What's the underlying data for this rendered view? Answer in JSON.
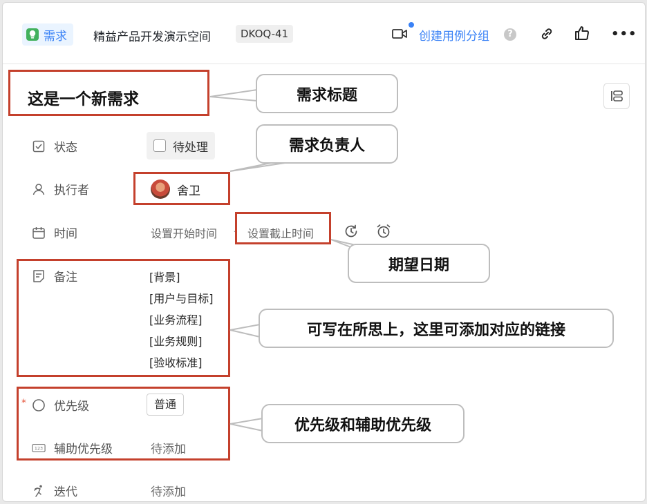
{
  "header": {
    "type_label": "需求",
    "space_name": "精益产品开发演示空间",
    "task_key": "DKOQ-41",
    "create_group_label": "创建用例分组",
    "help_symbol": "?",
    "more_symbol": "•••"
  },
  "title": "这是一个新需求",
  "fields": {
    "status": {
      "label": "状态",
      "value": "待处理"
    },
    "assignee": {
      "label": "执行者",
      "value": "舍卫"
    },
    "time": {
      "label": "时间",
      "start_placeholder": "设置开始时间",
      "separator": "-",
      "end_placeholder": "设置截止时间"
    },
    "notes": {
      "label": "备注",
      "lines": [
        "[背景]",
        "[用户与目标]",
        "[业务流程]",
        "[业务规则]",
        "[验收标准]"
      ]
    },
    "priority": {
      "label": "优先级",
      "value": "普通",
      "required_mark": "*"
    },
    "aux_priority": {
      "label": "辅助优先级",
      "value": "待添加"
    },
    "iteration": {
      "label": "迭代",
      "value": "待添加"
    }
  },
  "annotations": {
    "title_callout": "需求标题",
    "assignee_callout": "需求负责人",
    "due_callout": "期望日期",
    "notes_callout": "可写在所思上，这里可添加对应的链接",
    "priority_callout": "优先级和辅助优先级"
  },
  "colors": {
    "accent": "#3a82f6",
    "annotation_border": "#c4402c",
    "type_icon": "#42b15d",
    "required": "#e5553b"
  }
}
